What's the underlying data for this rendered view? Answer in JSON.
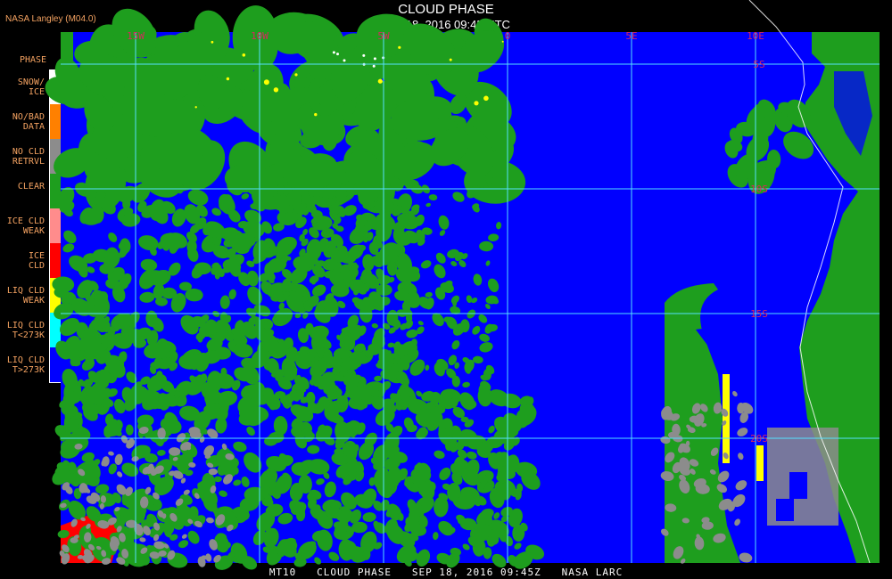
{
  "header": {
    "title": "CLOUD PHASE",
    "subtitle": "Sep 18, 2016 09:45 UTC",
    "source": "NASA Langley (M04.0)"
  },
  "legend": {
    "title": "PHASE",
    "items": [
      {
        "label": "SNOW/ ICE",
        "color": "#ffffff"
      },
      {
        "label": "NO/BAD DATA",
        "color": "#ff8000"
      },
      {
        "label": "NO CLD RETRVL",
        "color": "#8c8c8c"
      },
      {
        "label": "CLEAR",
        "color": "#1e9e1e"
      },
      {
        "label": "ICE CLD WEAK",
        "color": "#ff8c8c"
      },
      {
        "label": "ICE CLD",
        "color": "#ff0000"
      },
      {
        "label": "LIQ CLD WEAK",
        "color": "#ffff00"
      },
      {
        "label": "LIQ CLD T<273K",
        "color": "#00ffff"
      },
      {
        "label": "LIQ CLD T>273K",
        "color": "#0000ff"
      }
    ]
  },
  "map": {
    "longitude_labels": [
      "15W",
      "10W",
      "5W",
      "0",
      "5E",
      "10E"
    ],
    "latitude_labels": [
      "5S",
      "10S",
      "15S",
      "20S"
    ],
    "grid_color": "#55e0ff",
    "label_color": "#d8265f",
    "ocean_color": "#0000ff",
    "land_color": "#1e9e1e"
  },
  "footer": "MT10   CLOUD PHASE   SEP 18, 2016 09:45Z   NASA LARC"
}
